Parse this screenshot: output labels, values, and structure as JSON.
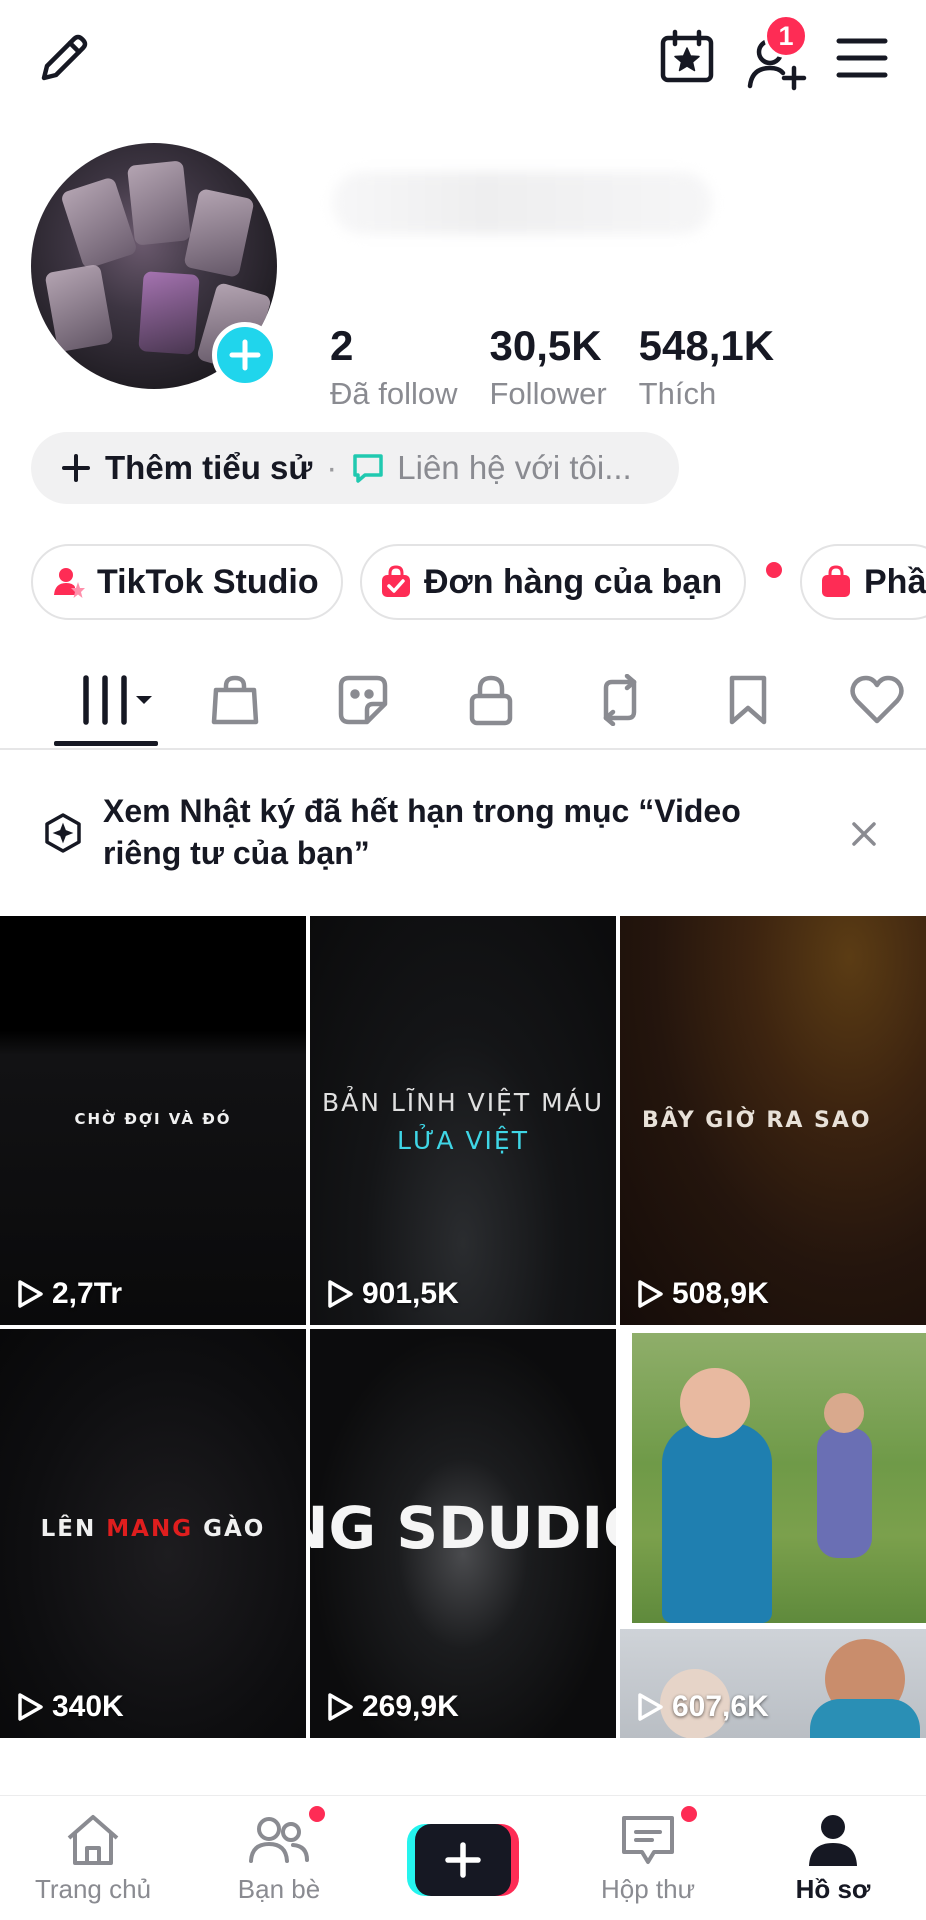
{
  "topbar": {
    "notification_count": "1",
    "icons": [
      "edit-pencil-icon",
      "calendar-star-icon",
      "add-friend-icon",
      "menu-icon"
    ]
  },
  "profile": {
    "stats": [
      {
        "value": "2",
        "label": "Đã follow"
      },
      {
        "value": "30,5K",
        "label": "Follower"
      },
      {
        "value": "548,1K",
        "label": "Thích"
      }
    ],
    "bio_add_label": "Thêm tiểu sử",
    "separator": "·",
    "contact_label": "Liên hệ với tôi..."
  },
  "chips": [
    {
      "label": "TikTok Studio",
      "icon": "studio-icon"
    },
    {
      "label": "Đơn hàng của bạn",
      "icon": "order-bag-icon",
      "has_dot": true
    },
    {
      "label": "Phầ",
      "icon": "shop-bag-icon"
    }
  ],
  "tabs": [
    "videos-grid",
    "shop",
    "stickers",
    "private",
    "reposts",
    "favorites",
    "liked"
  ],
  "notice": {
    "text": "Xem Nhật ký đã hết hạn trong mục “Video riêng tư của bạn”"
  },
  "videos": [
    {
      "caption": "CHỜ ĐỢI VÀ ĐÓ",
      "views": "2,7Tr"
    },
    {
      "caption": "BẢN LĨNH VIỆT MÁU",
      "caption2": "LỬA VIỆT",
      "views": "901,5K"
    },
    {
      "caption": "BÂY GIỜ RA SAO",
      "views": "508,9K"
    },
    {
      "caption_a": "LÊN ",
      "caption_b": "MANG",
      "caption_c": " GÀO",
      "views": "340K"
    },
    {
      "caption": "NG SDUDIO",
      "views": "269,9K"
    },
    {
      "caption": "",
      "views": "607,6K"
    }
  ],
  "bottom_nav": [
    {
      "label": "Trang chủ",
      "icon": "home-icon"
    },
    {
      "label": "Bạn bè",
      "icon": "friends-icon",
      "has_dot": true
    },
    {
      "label": "",
      "icon": "create-plus-icon"
    },
    {
      "label": "Hộp thư",
      "icon": "inbox-icon",
      "has_dot": true
    },
    {
      "label": "Hồ sơ",
      "icon": "profile-icon",
      "active": true
    }
  ],
  "colors": {
    "accent_red": "#fe2c55",
    "accent_cyan": "#20d5ec",
    "text_primary": "#161823",
    "text_secondary": "#8a8b91"
  }
}
